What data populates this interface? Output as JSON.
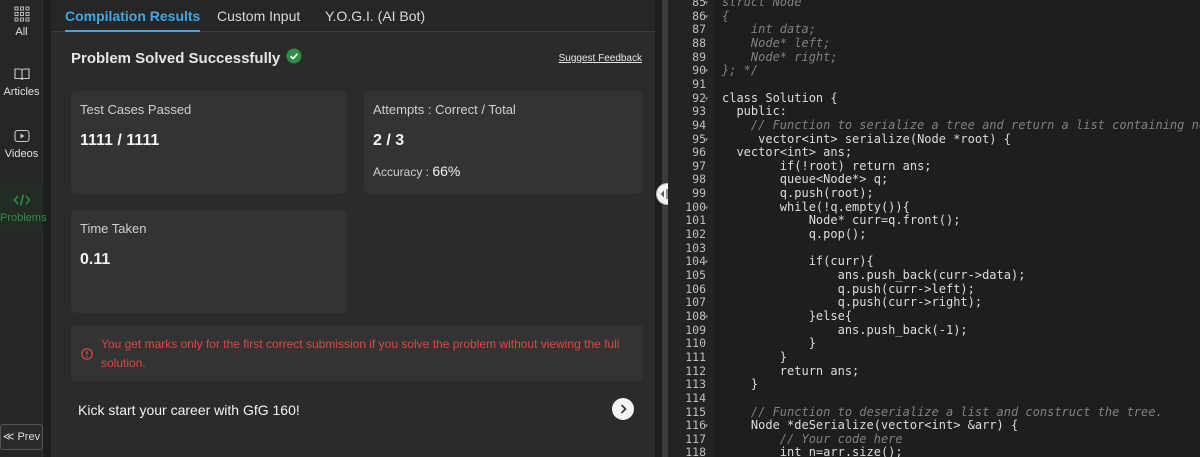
{
  "sidebar": {
    "items": [
      {
        "label": "All",
        "icon": "grid-icon"
      },
      {
        "label": "Articles",
        "icon": "book-icon"
      },
      {
        "label": "Videos",
        "icon": "play-icon"
      },
      {
        "label": "Problems",
        "icon": "code-icon"
      }
    ],
    "prev_label": "≪ Prev"
  },
  "tabs": [
    "Compilation Results",
    "Custom Input",
    "Y.O.G.I. (AI Bot)"
  ],
  "result": {
    "status": "Problem Solved Successfully",
    "suggest_feedback": "Suggest Feedback",
    "test_cases_title": "Test Cases Passed",
    "test_cases_value": "1111 / 1111",
    "attempts_title": "Attempts : Correct / Total",
    "attempts_value": "2 / 3",
    "accuracy_label": "Accuracy :",
    "accuracy_value": "66%",
    "time_title": "Time Taken",
    "time_value": "0.11"
  },
  "warning": "You get marks only for the first correct submission if you solve the problem without viewing the full solution.",
  "promo": "Kick start your career with GfG 160!",
  "colors": {
    "accent_blue": "#3ea7e8",
    "success_green": "#2f8d46",
    "warning_red": "#e0463f"
  },
  "editor": {
    "lines": [
      {
        "n": "85",
        "fold": true,
        "text": "struct Node"
      },
      {
        "n": "86",
        "fold": true,
        "text": "{"
      },
      {
        "n": "87",
        "fold": false,
        "text": "    int data;"
      },
      {
        "n": "88",
        "fold": false,
        "text": "    Node* left;"
      },
      {
        "n": "89",
        "fold": false,
        "text": "    Node* right;"
      },
      {
        "n": "90",
        "fold": true,
        "text": "}; */"
      },
      {
        "n": "91",
        "fold": false,
        "text": ""
      },
      {
        "n": "92",
        "fold": true,
        "text": "class Solution {"
      },
      {
        "n": "93",
        "fold": false,
        "text": "  public:"
      },
      {
        "n": "94",
        "fold": false,
        "text": "    // Function to serialize a tree and return a list containing nodes of"
      },
      {
        "n": "95",
        "fold": true,
        "text": "     vector<int> serialize(Node *root) {"
      },
      {
        "n": "96",
        "fold": false,
        "text": "  vector<int> ans;"
      },
      {
        "n": "97",
        "fold": false,
        "text": "        if(!root) return ans;"
      },
      {
        "n": "98",
        "fold": false,
        "text": "        queue<Node*> q;"
      },
      {
        "n": "99",
        "fold": false,
        "text": "        q.push(root);"
      },
      {
        "n": "100",
        "fold": true,
        "text": "        while(!q.empty()){"
      },
      {
        "n": "101",
        "fold": false,
        "text": "            Node* curr=q.front();"
      },
      {
        "n": "102",
        "fold": false,
        "text": "            q.pop();"
      },
      {
        "n": "103",
        "fold": false,
        "text": ""
      },
      {
        "n": "104",
        "fold": true,
        "text": "            if(curr){"
      },
      {
        "n": "105",
        "fold": false,
        "text": "                ans.push_back(curr->data);"
      },
      {
        "n": "106",
        "fold": false,
        "text": "                q.push(curr->left);"
      },
      {
        "n": "107",
        "fold": false,
        "text": "                q.push(curr->right);"
      },
      {
        "n": "108",
        "fold": true,
        "text": "            }else{"
      },
      {
        "n": "109",
        "fold": false,
        "text": "                ans.push_back(-1);"
      },
      {
        "n": "110",
        "fold": false,
        "text": "            }"
      },
      {
        "n": "111",
        "fold": false,
        "text": "        }"
      },
      {
        "n": "112",
        "fold": false,
        "text": "        return ans;"
      },
      {
        "n": "113",
        "fold": false,
        "text": "    }"
      },
      {
        "n": "114",
        "fold": false,
        "text": ""
      },
      {
        "n": "115",
        "fold": false,
        "text": "    // Function to deserialize a list and construct the tree."
      },
      {
        "n": "116",
        "fold": true,
        "text": "    Node *deSerialize(vector<int> &arr) {"
      },
      {
        "n": "117",
        "fold": false,
        "text": "        // Your code here"
      },
      {
        "n": "118",
        "fold": false,
        "text": "        int n=arr.size();"
      }
    ]
  }
}
